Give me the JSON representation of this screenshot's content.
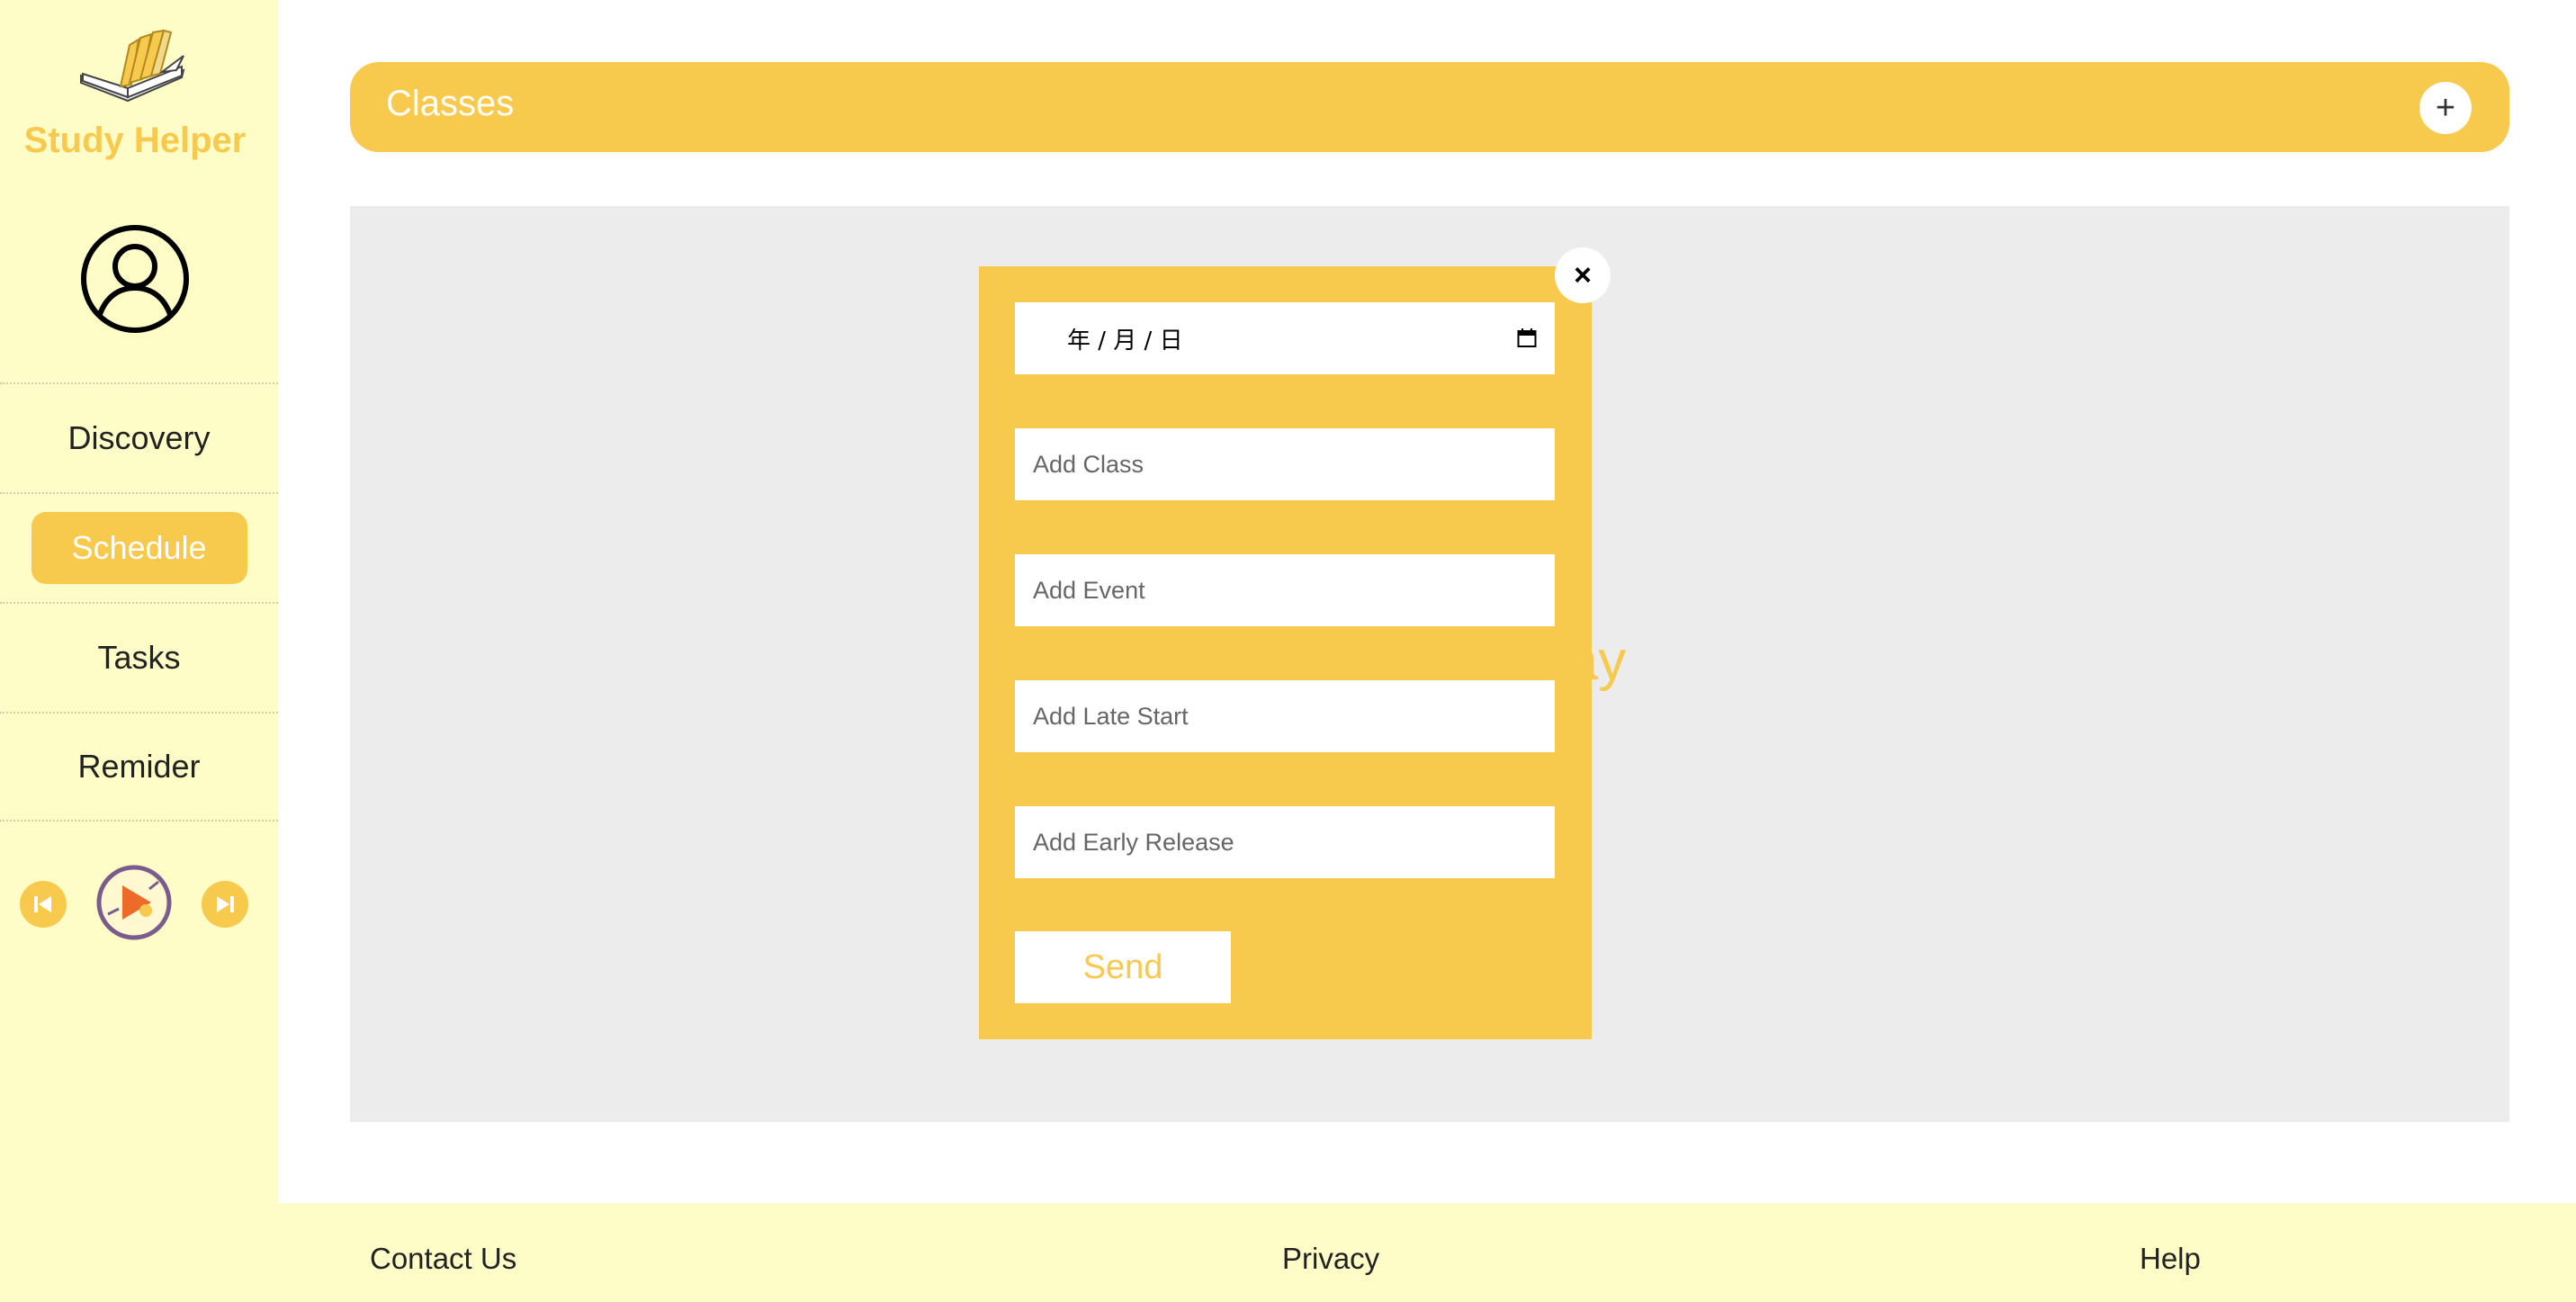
{
  "app": {
    "title": "Study Helper"
  },
  "sidebar": {
    "items": [
      {
        "label": "Discovery"
      },
      {
        "label": "Schedule",
        "active": true
      },
      {
        "label": "Tasks"
      },
      {
        "label": "Remider"
      }
    ],
    "player": {
      "prev_icon": "skip-back-icon",
      "play_icon": "play-icon",
      "next_icon": "skip-forward-icon"
    }
  },
  "header": {
    "title": "Classes",
    "add_label": "+"
  },
  "main": {
    "empty_message": "his day"
  },
  "modal": {
    "close_label": "×",
    "date_value": "年  / 月 / 日",
    "fields": [
      {
        "placeholder": "Add Class"
      },
      {
        "placeholder": "Add Event"
      },
      {
        "placeholder": "Add Late Start"
      },
      {
        "placeholder": "Add Early Release"
      }
    ],
    "send_label": "Send"
  },
  "footer": {
    "links": [
      "Contact Us",
      "Privacy",
      "Help"
    ]
  },
  "colors": {
    "accent": "#f7c94d",
    "sidebar_bg": "#fefdc8",
    "content_bg": "#ececec"
  }
}
